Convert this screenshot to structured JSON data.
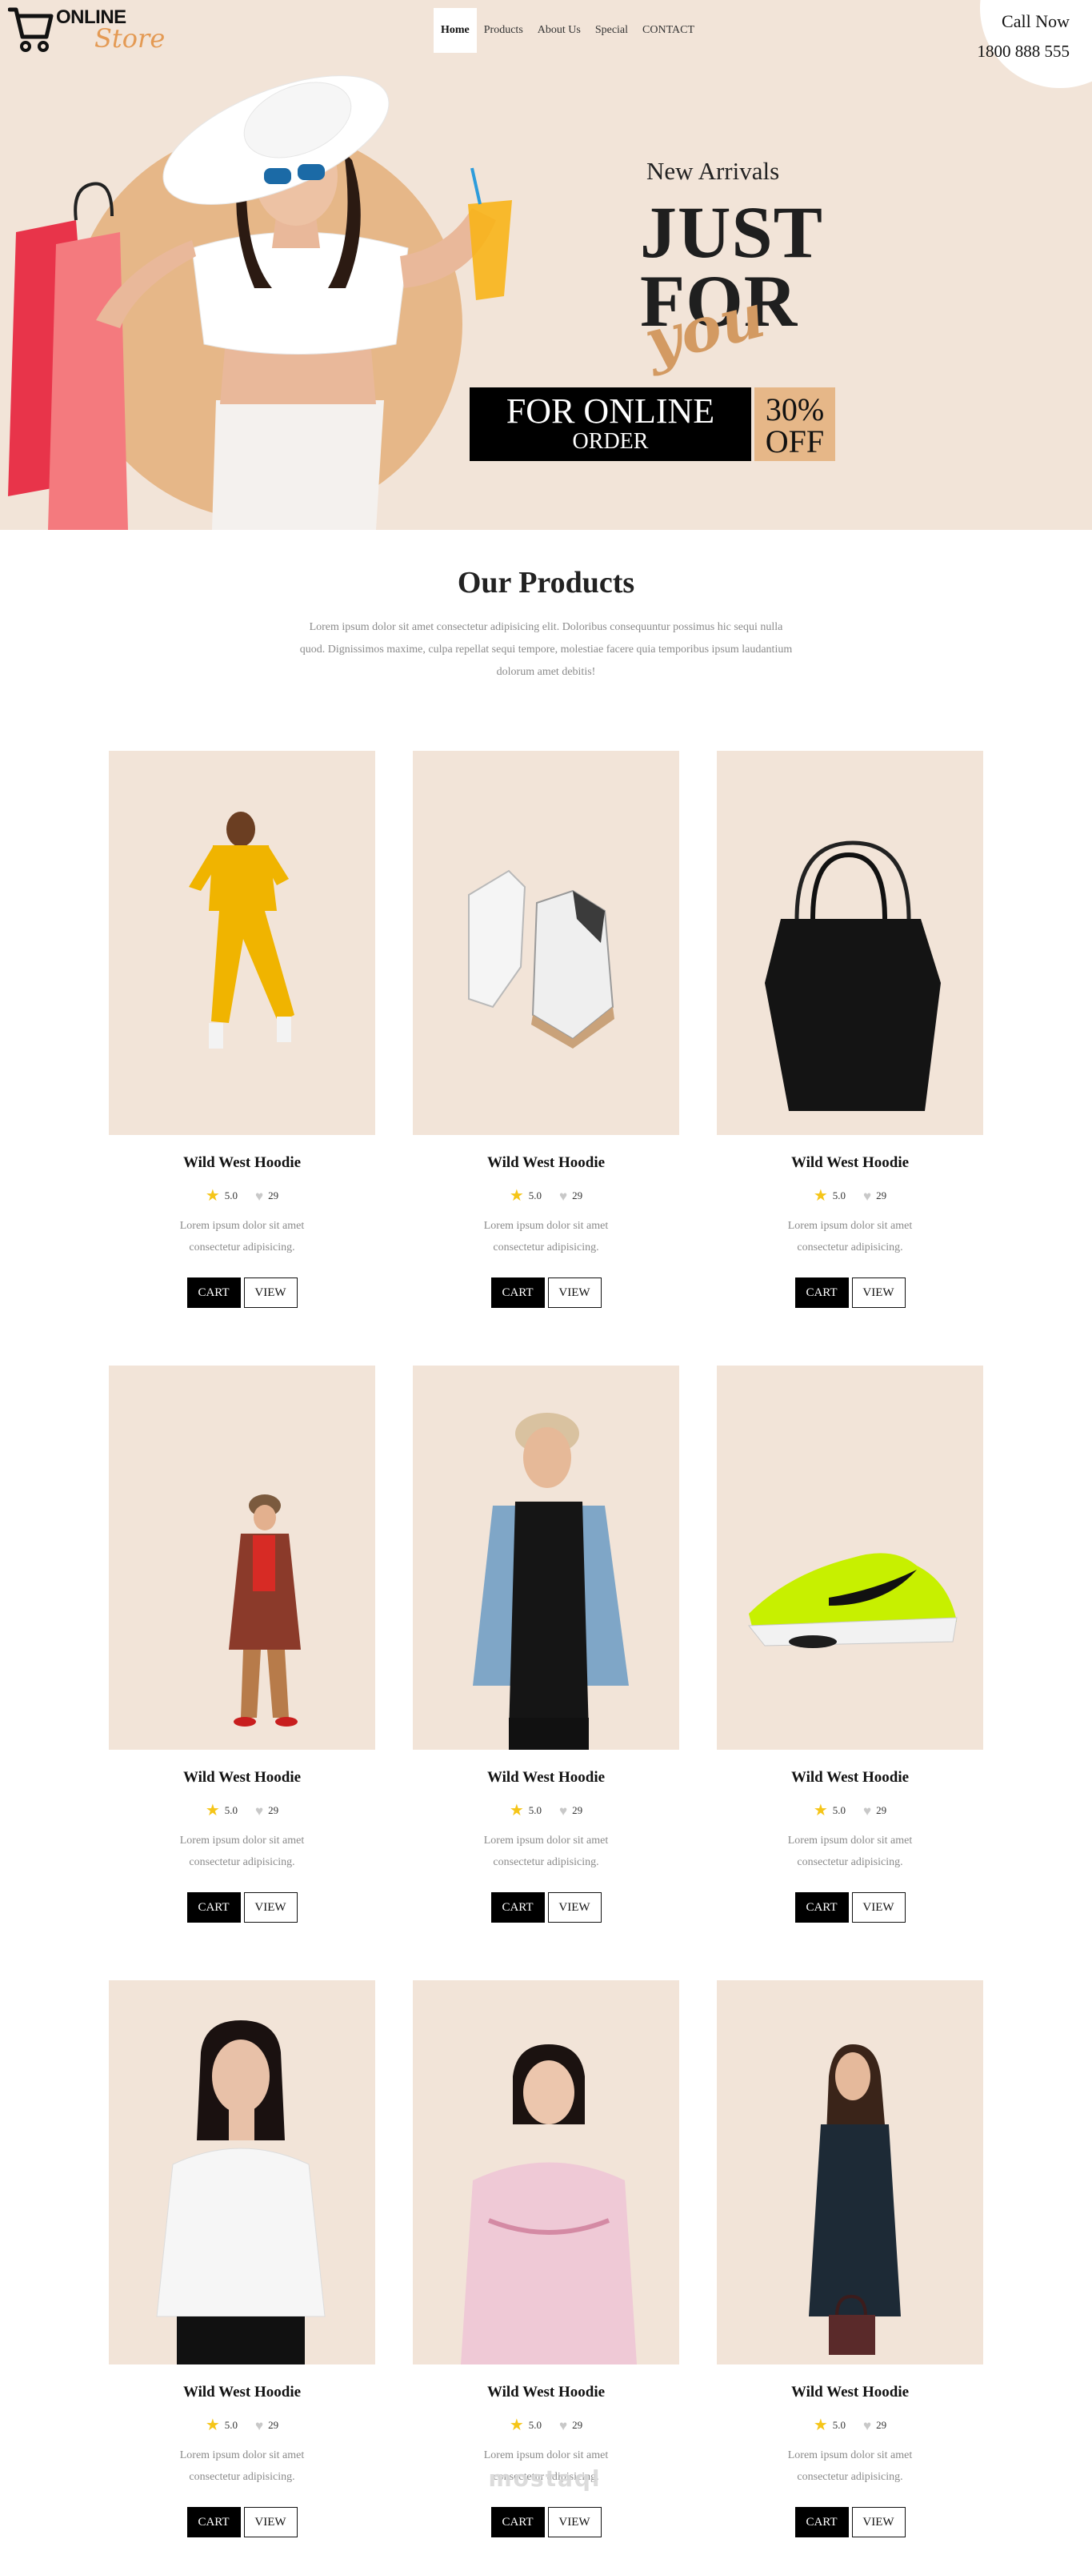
{
  "brand": {
    "line1": "ONLINE",
    "line2": "Store",
    "accent_color": "#e49a54"
  },
  "nav": {
    "items": [
      {
        "label": "Home",
        "active": true
      },
      {
        "label": "Products",
        "active": false
      },
      {
        "label": "About Us",
        "active": false
      },
      {
        "label": "Special",
        "active": false
      },
      {
        "label": "CONTACT",
        "active": false
      }
    ]
  },
  "contact": {
    "label": "Call Now",
    "phone": "1800 888 555"
  },
  "hero": {
    "kicker": "New Arrivals",
    "headline_1": "JUST",
    "headline_2": "FOR",
    "headline_script": "you",
    "promo_line_1": "FOR ONLINE",
    "promo_line_2": "ORDER",
    "discount": "30%",
    "discount_suffix": "OFF",
    "background_color": "#f2e4d8",
    "accent_color": "#e6b788"
  },
  "products_section": {
    "title": "Our Products",
    "description": "Lorem ipsum dolor sit amet consectetur adipisicing elit. Doloribus consequuntur possimus hic sequi nulla quod. Dignissimos maxime, culpa repellat sequi tempore, molestiae facere quia temporibus ipsum laudantium dolorum amet debitis!"
  },
  "products": [
    {
      "name": "Wild West Hoodie",
      "rating": "5.0",
      "likes": "29",
      "description": "Lorem ipsum dolor sit amet consectetur adipisicing.",
      "cart_label": "CART",
      "view_label": "VIEW",
      "image": "woman-yellow-tracksuit"
    },
    {
      "name": "Wild West Hoodie",
      "rating": "5.0",
      "likes": "29",
      "description": "Lorem ipsum dolor sit amet consectetur adipisicing.",
      "cart_label": "CART",
      "view_label": "VIEW",
      "image": "white-high-top-sneakers"
    },
    {
      "name": "Wild West Hoodie",
      "rating": "5.0",
      "likes": "29",
      "description": "Lorem ipsum dolor sit amet consectetur adipisicing.",
      "cart_label": "CART",
      "view_label": "VIEW",
      "image": "black-tote-bag"
    },
    {
      "name": "Wild West Hoodie",
      "rating": "5.0",
      "likes": "29",
      "description": "Lorem ipsum dolor sit amet consectetur adipisicing.",
      "cart_label": "CART",
      "view_label": "VIEW",
      "image": "woman-patterned-coat"
    },
    {
      "name": "Wild West Hoodie",
      "rating": "5.0",
      "likes": "29",
      "description": "Lorem ipsum dolor sit amet consectetur adipisicing.",
      "cart_label": "CART",
      "view_label": "VIEW",
      "image": "man-denim-jacket"
    },
    {
      "name": "Wild West Hoodie",
      "rating": "5.0",
      "likes": "29",
      "description": "Lorem ipsum dolor sit amet consectetur adipisicing.",
      "cart_label": "CART",
      "view_label": "VIEW",
      "image": "neon-running-shoe"
    },
    {
      "name": "Wild West Hoodie",
      "rating": "5.0",
      "likes": "29",
      "description": "Lorem ipsum dolor sit amet consectetur adipisicing.",
      "cart_label": "CART",
      "view_label": "VIEW",
      "image": "woman-white-ruffle-blouse"
    },
    {
      "name": "Wild West Hoodie",
      "rating": "5.0",
      "likes": "29",
      "description": "Lorem ipsum dolor sit amet consectetur adipisicing.",
      "cart_label": "CART",
      "view_label": "VIEW",
      "image": "woman-pink-floral-top"
    },
    {
      "name": "Wild West Hoodie",
      "rating": "5.0",
      "likes": "29",
      "description": "Lorem ipsum dolor sit amet consectetur adipisicing.",
      "cart_label": "CART",
      "view_label": "VIEW",
      "image": "woman-dark-coat-handbag"
    }
  ],
  "icons": {
    "cart": "shopping-cart-icon",
    "rating": "star-icon",
    "likes": "heart-icon"
  },
  "watermark": "mostaql"
}
